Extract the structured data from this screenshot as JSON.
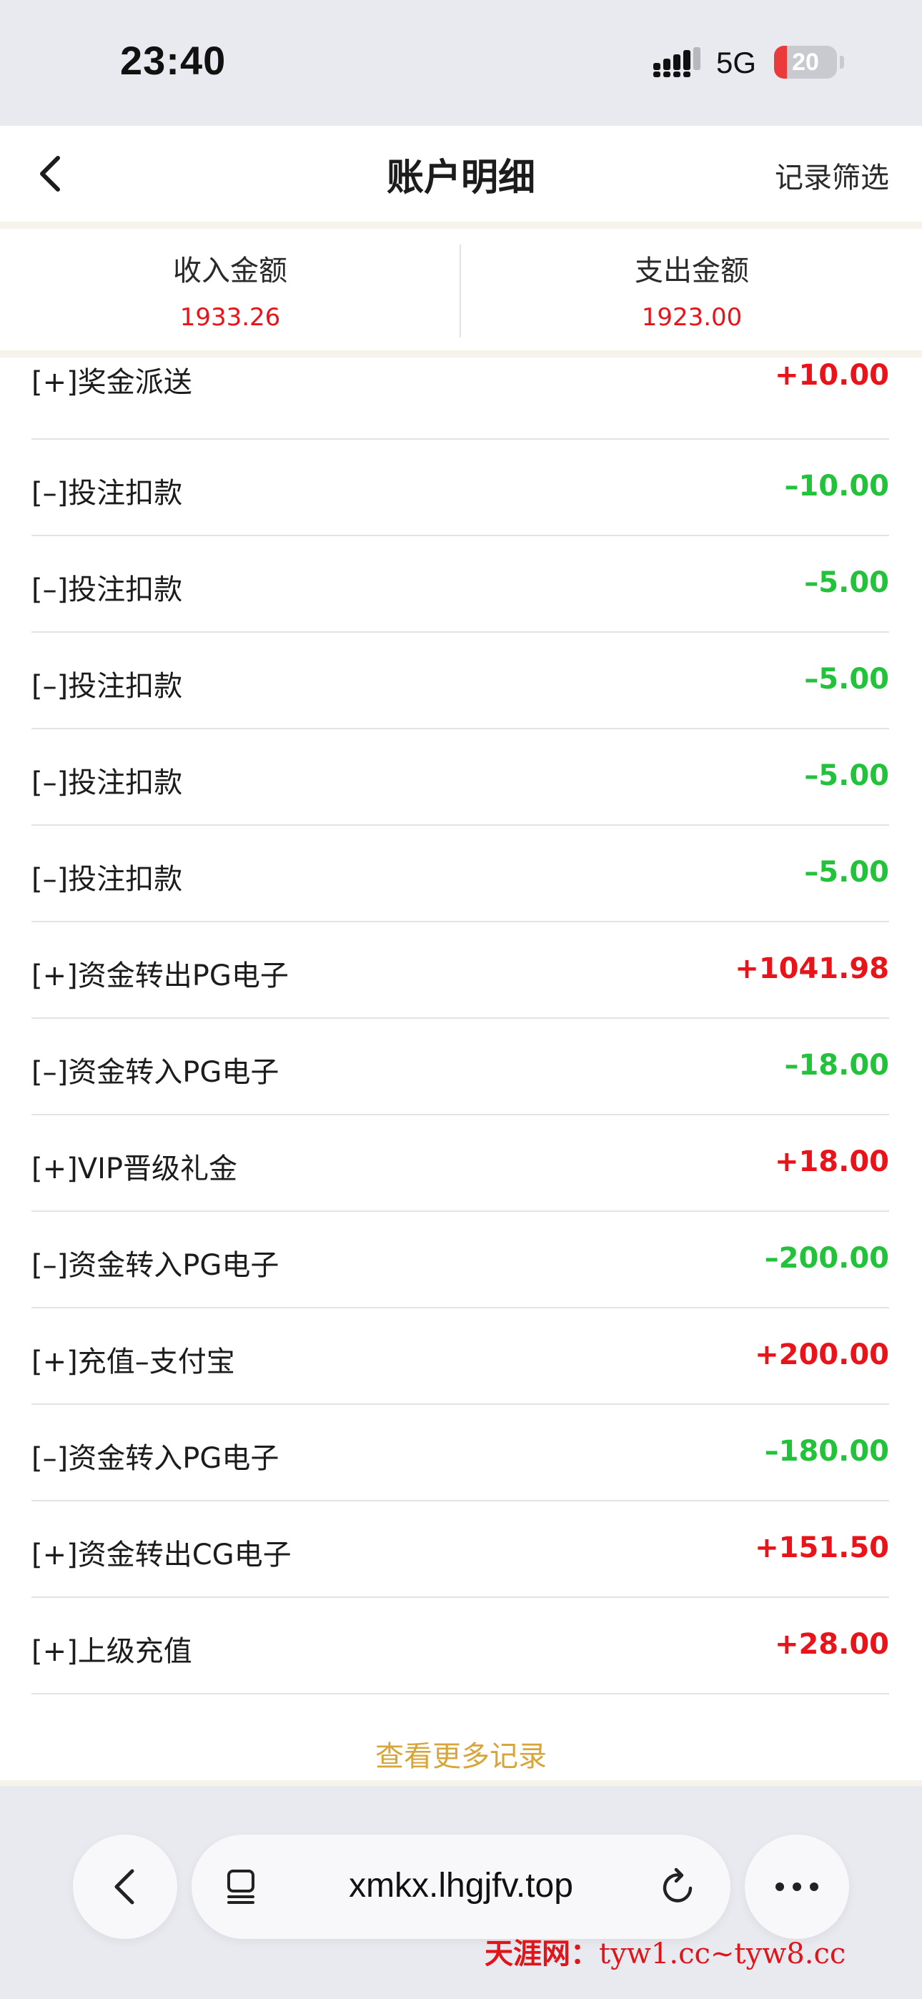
{
  "status_bar": {
    "time": "23:40",
    "network": "5G",
    "battery_level": "20",
    "battery_fraction": 0.2
  },
  "header": {
    "title": "账户明细",
    "filter_label": "记录筛选",
    "back_icon": "chevron-left-icon"
  },
  "summary": {
    "income_label": "收入金额",
    "income_value": "1933.26",
    "expense_label": "支出金额",
    "expense_value": "1923.00"
  },
  "colors": {
    "positive": "#e8141a",
    "negative": "#22c23a",
    "accent_gold": "#d7a63a"
  },
  "records": [
    {
      "label": "[+]奖金派送",
      "amount": "+10.00",
      "sign": "+"
    },
    {
      "label": "[–]投注扣款",
      "amount": "–10.00",
      "sign": "-"
    },
    {
      "label": "[–]投注扣款",
      "amount": "–5.00",
      "sign": "-"
    },
    {
      "label": "[–]投注扣款",
      "amount": "–5.00",
      "sign": "-"
    },
    {
      "label": "[–]投注扣款",
      "amount": "–5.00",
      "sign": "-"
    },
    {
      "label": "[–]投注扣款",
      "amount": "–5.00",
      "sign": "-"
    },
    {
      "label": "[+]资金转出PG电子",
      "amount": "+1041.98",
      "sign": "+"
    },
    {
      "label": "[–]资金转入PG电子",
      "amount": "–18.00",
      "sign": "-"
    },
    {
      "label": "[+]VIP晋级礼金",
      "amount": "+18.00",
      "sign": "+"
    },
    {
      "label": "[–]资金转入PG电子",
      "amount": "–200.00",
      "sign": "-"
    },
    {
      "label": "[+]充值–支付宝",
      "amount": "+200.00",
      "sign": "+"
    },
    {
      "label": "[–]资金转入PG电子",
      "amount": "–180.00",
      "sign": "-"
    },
    {
      "label": "[+]资金转出CG电子",
      "amount": "+151.50",
      "sign": "+"
    },
    {
      "label": "[+]上级充值",
      "amount": "+28.00",
      "sign": "+"
    }
  ],
  "more_label": "查看更多记录",
  "browser": {
    "url": "xmkx.lhgjfv.top",
    "back_icon": "chevron-left-icon",
    "tabs_icon": "tabs-icon",
    "reload_icon": "reload-icon",
    "more_icon": "more-icon"
  },
  "watermark": {
    "brand": "天涯网：",
    "url": "tyw1.cc~tyw8.cc"
  }
}
